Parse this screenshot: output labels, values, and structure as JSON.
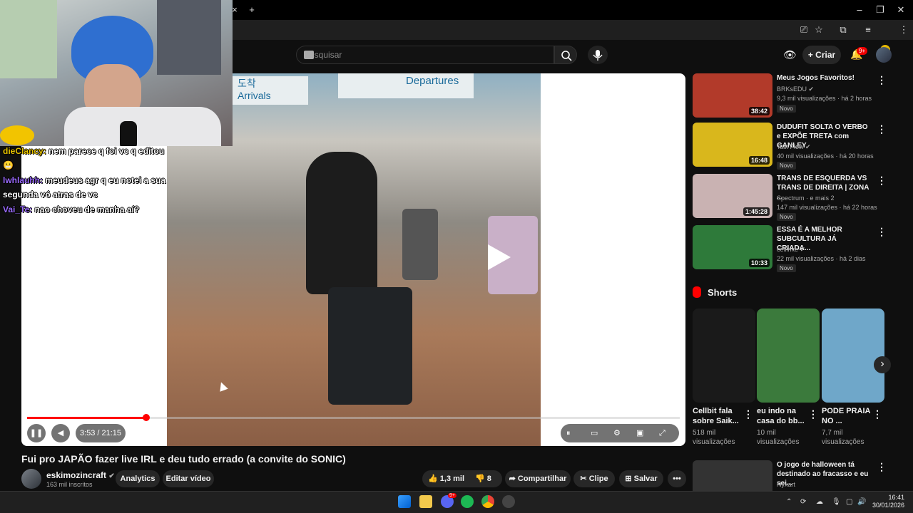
{
  "chrome": {
    "tab_close": "×",
    "new_tab": "+",
    "win_min": "–",
    "win_restore": "❐",
    "win_close": "✕"
  },
  "header": {
    "search_placeholder": "Pesquisar",
    "create_label": "Criar",
    "notif_badge": "9+"
  },
  "chat": [
    {
      "user": "dieClancy:",
      "text": " nem parece q foi vc q editou"
    },
    {
      "user": "",
      "text": "😬"
    },
    {
      "user": "lwhlauhh:",
      "text": " meudeus agr q eu notei a sua"
    },
    {
      "user": "",
      "text": "segunda vó atras de vc"
    },
    {
      "user": "Vai_Te:",
      "text": " nao choveu de manha aí?"
    }
  ],
  "player": {
    "time": "3:53 / 21:15",
    "progress_fraction": 0.183,
    "poster_arrivals": "도착\nArrivals",
    "poster_departures": "Departures"
  },
  "video": {
    "title": "Fui pro JAPÃO fazer live IRL e deu tudo errado (a convite do SONIC)",
    "channel": "eskimozincraft",
    "subscribers": "163 mil inscritos",
    "analytics": "Analytics",
    "edit": "Editar vídeo",
    "likes": "1,3 mil",
    "dislikes": "8",
    "share": "Compartilhar",
    "clip": "Clipe",
    "save": "Salvar"
  },
  "recommendations": [
    {
      "title": "Meus Jogos Favoritos!",
      "channel": "BRKsEDU",
      "meta": "9,3 mil visualizações · há 2 horas",
      "badge": "Novo",
      "duration": "38:42",
      "color": "#b23a2a"
    },
    {
      "title": "DUDUFIT SOLTA O VERBO e EXPÕE TRETA com GANLEY",
      "channel": "Talk Flow",
      "meta": "40 mil visualizações · há 20 horas",
      "badge": "Novo",
      "duration": "16:48",
      "color": "#d9b71c"
    },
    {
      "title": "TRANS DE ESQUERDA VS TRANS DE DIREITA | ZONA ...",
      "channel": "Spectrum · e mais 2",
      "meta": "147 mil visualizações · há 22 horas",
      "badge": "Novo",
      "duration": "1:45:28",
      "color": "#c9b2b2"
    },
    {
      "title": "ESSA É A MELHOR SUBCULTURA JÁ CRIADA...",
      "channel": "cellinke",
      "meta": "22 mil visualizações · há 2 dias",
      "badge": "Novo",
      "duration": "10:33",
      "color": "#2e7a3a"
    }
  ],
  "shorts": {
    "heading": "Shorts",
    "items": [
      {
        "title": "Cellbit fala sobre Saik...",
        "views": "518 mil visualizações",
        "color": "#1a1a1a"
      },
      {
        "title": "eu indo na casa do bb...",
        "views": "10 mil visualizações",
        "color": "#3b7a3c"
      },
      {
        "title": "PODE PRAIA NO ...",
        "views": "7,7 mil visualizações",
        "color": "#6fa7c9"
      }
    ],
    "next": "›"
  },
  "partial_rec": {
    "title": "O jogo de halloween tá destinado ao fracasso e eu sei...",
    "channel": "Nyxart"
  },
  "taskbar": {
    "time": "16:41",
    "date": "30/01/2026",
    "discord_badge": "9+"
  }
}
